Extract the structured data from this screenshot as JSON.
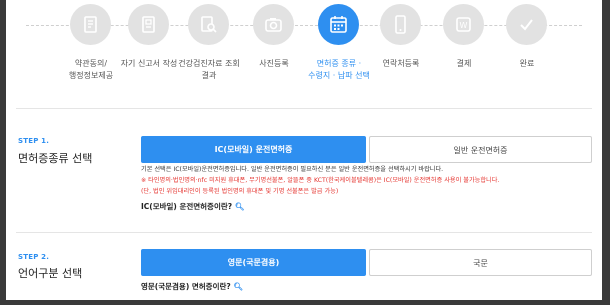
{
  "steps": [
    {
      "label": "약관동의/\n행정정보제공",
      "icon": "document-icon",
      "active": false
    },
    {
      "label": "자기 신고서 작성",
      "icon": "form-icon",
      "active": false
    },
    {
      "label": "건강검진자료 조회\n결과",
      "icon": "search-doc-icon",
      "active": false
    },
    {
      "label": "사진등록",
      "icon": "camera-icon",
      "active": false
    },
    {
      "label": "면허증 종류 ·\n수령지 · 납파 선택",
      "icon": "calendar-icon",
      "active": true
    },
    {
      "label": "연락처등록",
      "icon": "phone-icon",
      "active": false
    },
    {
      "label": "결제",
      "icon": "wallet-icon",
      "active": false
    },
    {
      "label": "완료",
      "icon": "check-icon",
      "active": false
    }
  ],
  "section1": {
    "step": "STEP 1.",
    "title": "면허증종류 선택",
    "option_mobile": "IC(모바일) 운전면허증",
    "option_general": "일반 운전면허증",
    "desc_line1": "기본 선택은 IC(모바일)운전면허증입니다. 일반 운전면허증이 필요하신 분은 일반 운전면허증을 선택하시기 바랍니다.",
    "desc_line2": "※ 타인명의·법인명의·nfc 미지원 휴대폰, 무기명선불폰, 알뜰폰 중 KCT(한국케이블텔레콤)은 IC(모바일) 운전면허증 사용이 불가능합니다.",
    "desc_line3": "(단, 법인 위임대리인이 등록된 법인명의 휴대폰 및 기명 선불폰은 발급 가능)",
    "info_link": "IC(모바일) 운전면허증이란?"
  },
  "section2": {
    "step": "STEP 2.",
    "title": "언어구분 선택",
    "option_english": "영문(국문겸용)",
    "option_korean": "국문",
    "info_link": "영문(국문겸용) 면허증이란?"
  },
  "colors": {
    "accent": "#2e8ff0",
    "warning": "#e5322d",
    "inactive": "#e2e2e2"
  }
}
